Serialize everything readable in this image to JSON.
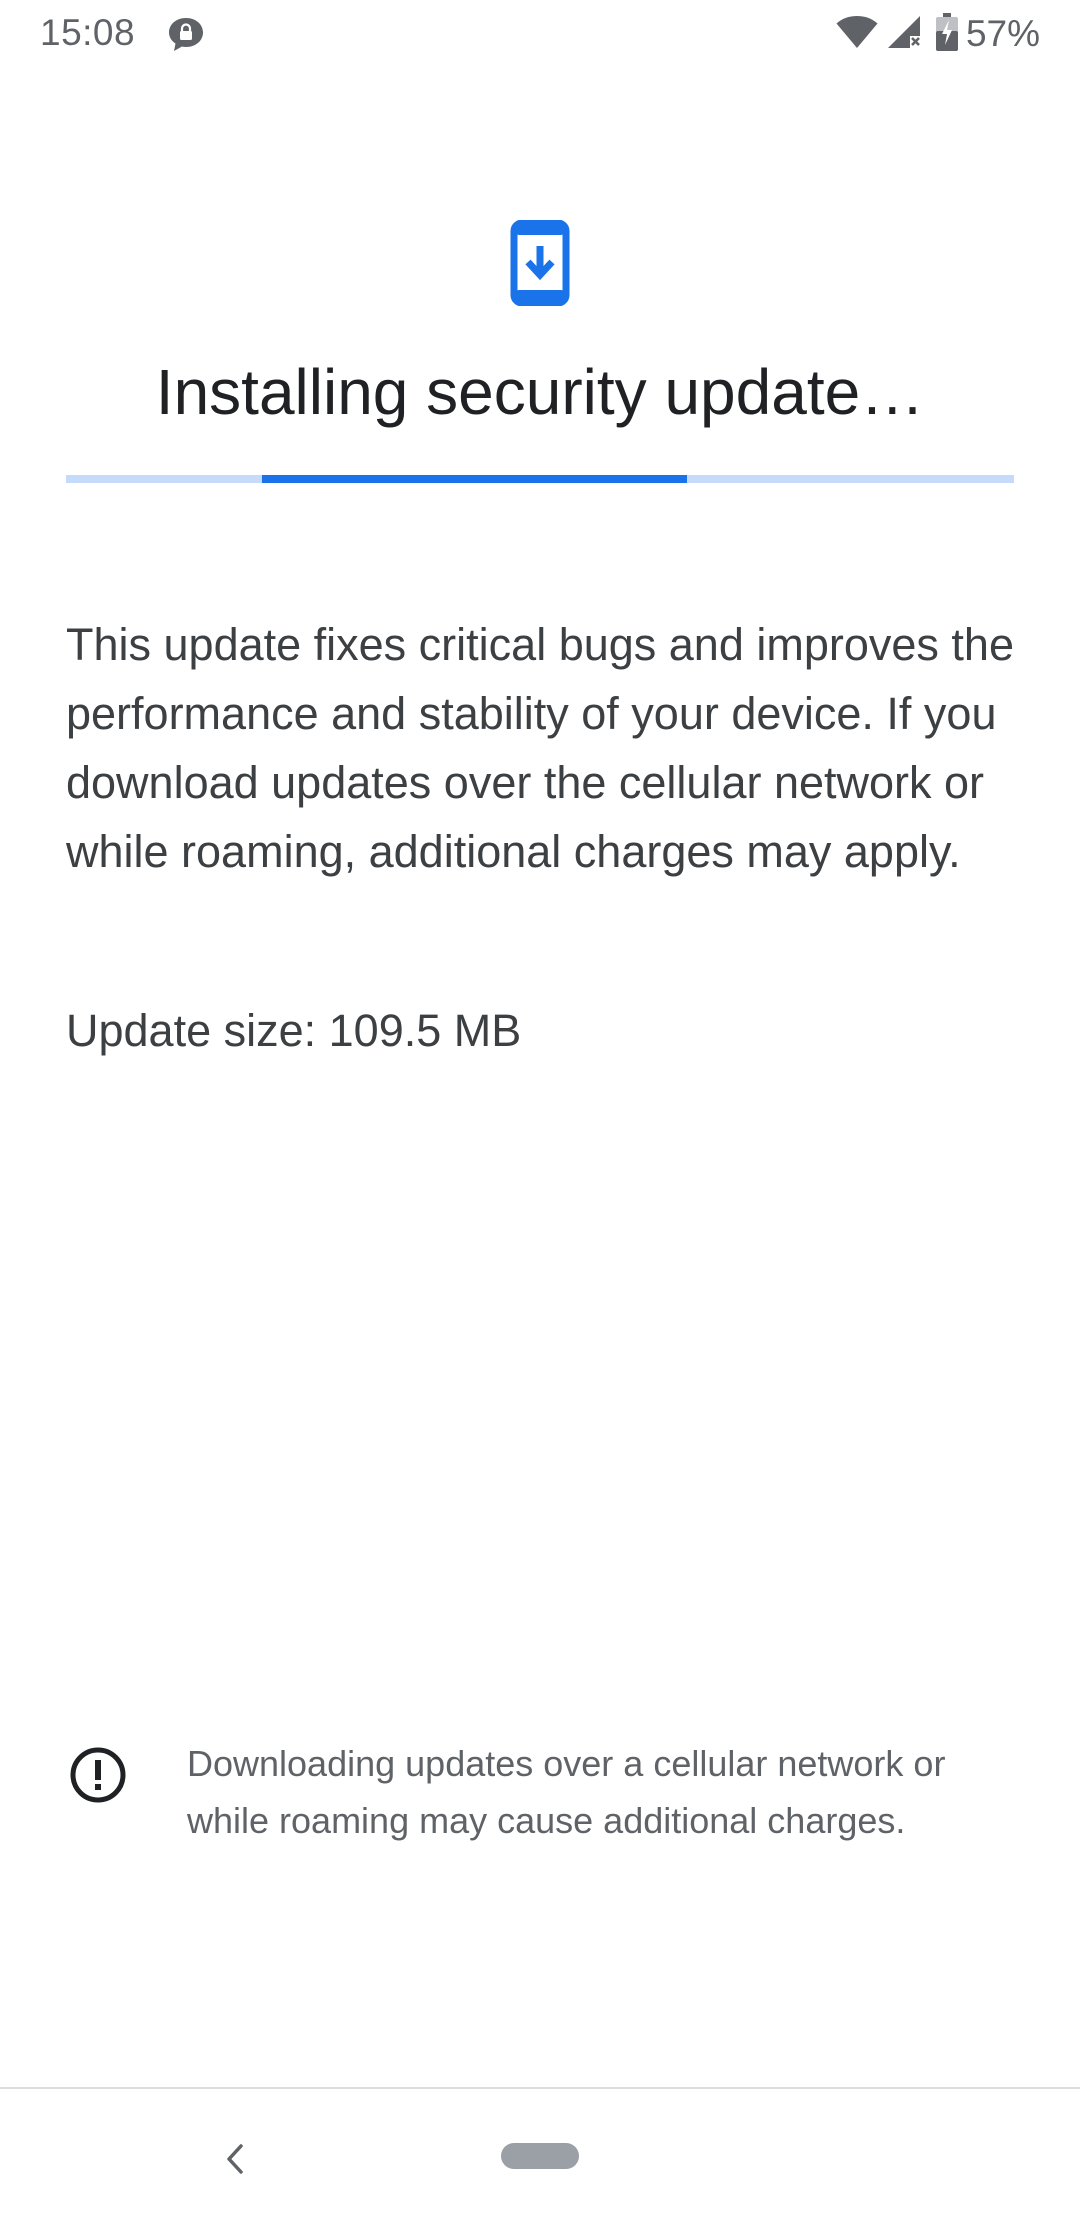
{
  "status_bar": {
    "time": "15:08",
    "notification_icon": "vpn-key-bubble-icon",
    "wifi_icon": "wifi-icon",
    "signal_icon": "cellular-no-signal-icon",
    "battery_icon": "battery-charging-icon",
    "battery_percent": "57%"
  },
  "header": {
    "icon": "phone-download-icon",
    "title": "Installing security update…"
  },
  "progress": {
    "style": "indeterminate",
    "segment_start_fraction": 0.207,
    "segment_end_fraction": 0.655
  },
  "content": {
    "description": "This update fixes critical bugs and improves the performance and stability of your device. If you download updates over the cellular network or while roaming, additional charges may apply.",
    "update_size": "Update size: 109.5 MB"
  },
  "warning": {
    "icon": "alert-circle-icon",
    "text": "Downloading updates over a cellular network or while roaming may cause additional charges."
  },
  "nav_bar": {
    "back_icon": "back-chevron-icon",
    "home_icon": "home-pill-icon"
  },
  "colors": {
    "accent": "#1a73e8",
    "progress_track": "#c6dafc",
    "title_text": "#202124",
    "body_text": "#3c4043",
    "secondary_text": "#5f6368",
    "nav_pill": "#9aa0a6"
  }
}
